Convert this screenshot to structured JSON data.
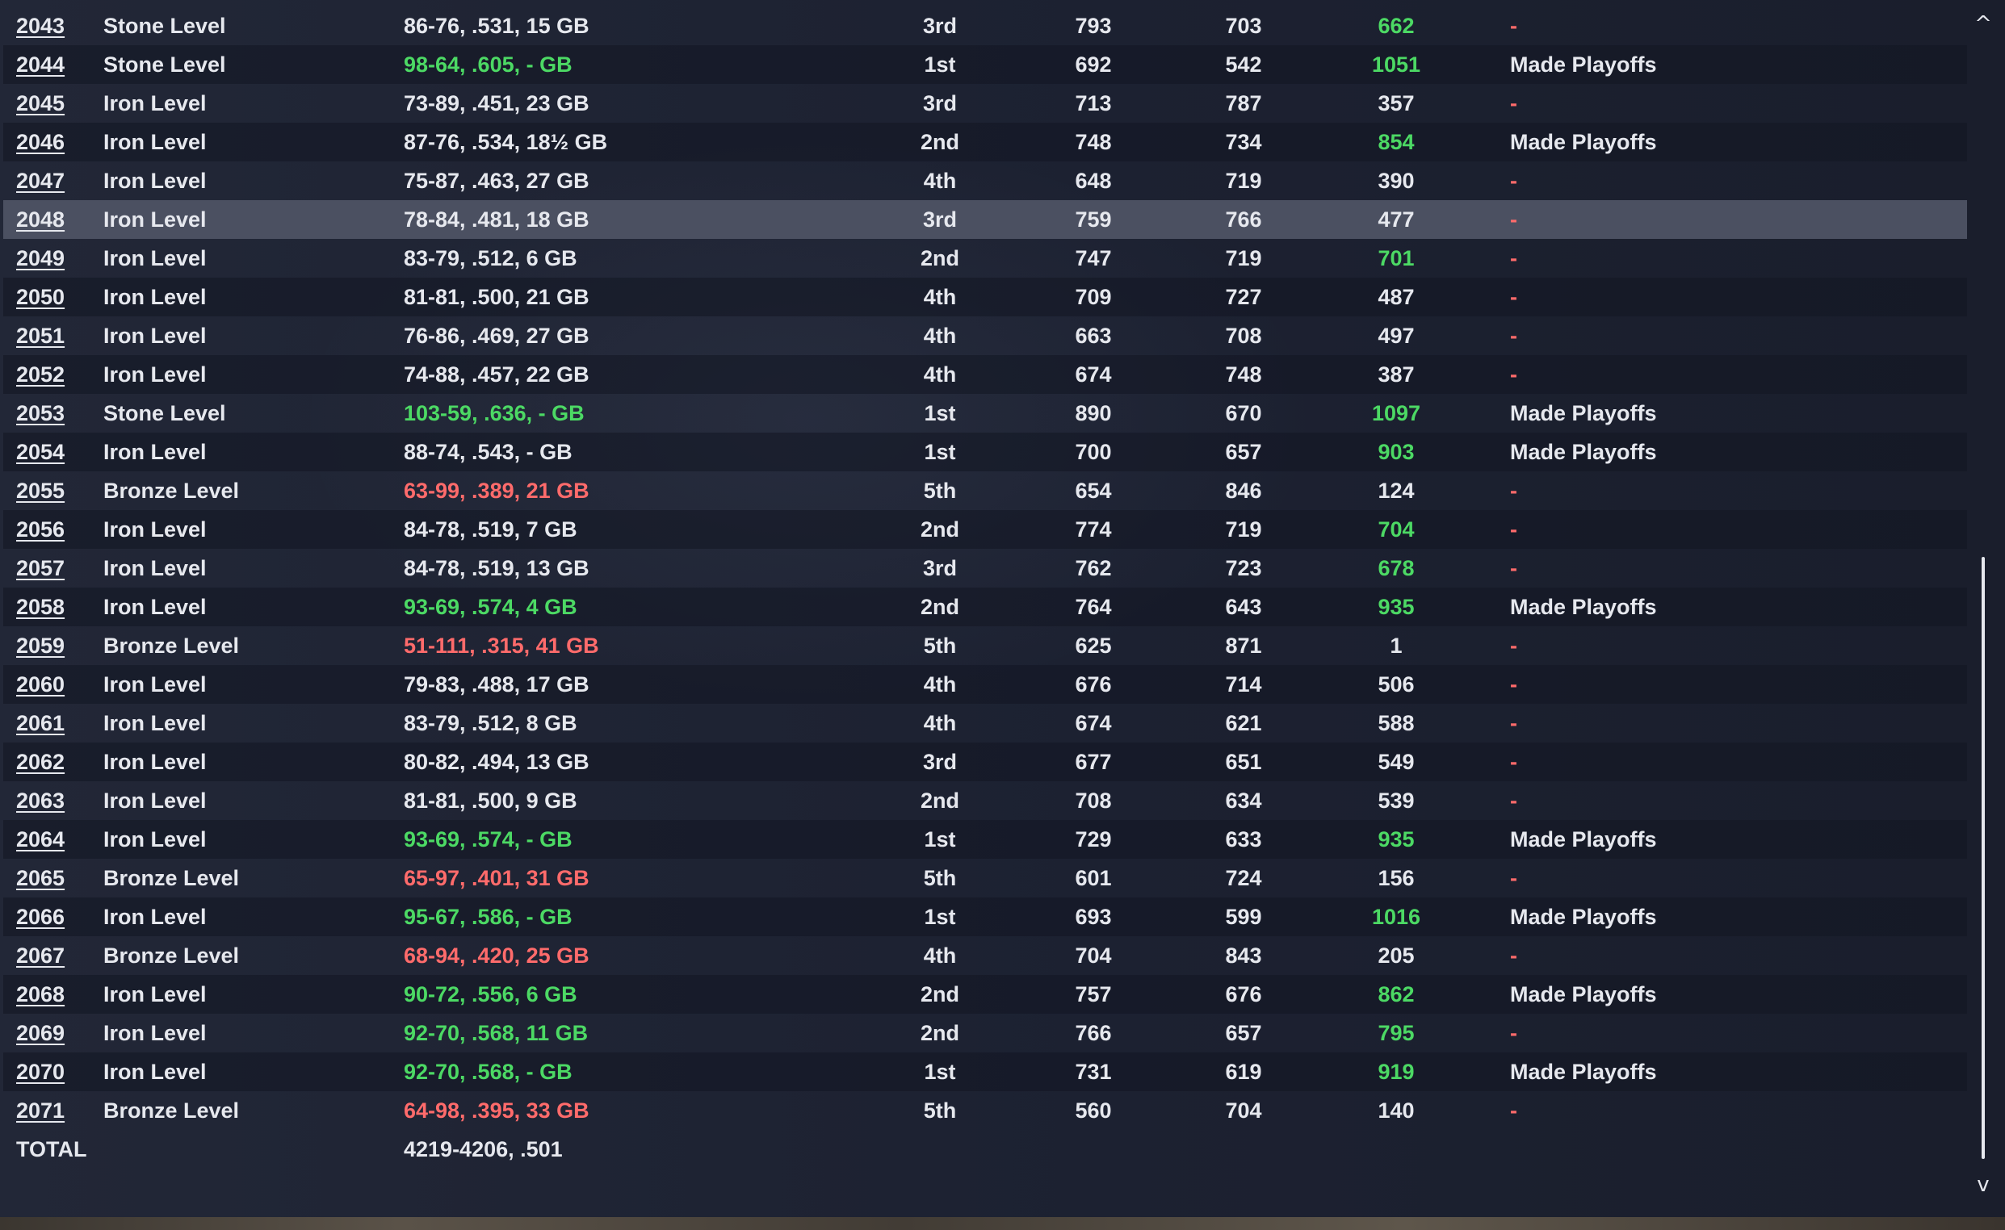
{
  "rows": [
    {
      "year": "2043",
      "level": "Stone Level",
      "record": "86-76, .531, 15 GB",
      "record_status": "normal",
      "finish": "3rd",
      "rs": "793",
      "ra": "703",
      "rating": "662",
      "rating_status": "good",
      "note": "-"
    },
    {
      "year": "2044",
      "level": "Stone Level",
      "record": "98-64, .605, - GB",
      "record_status": "good",
      "finish": "1st",
      "rs": "692",
      "ra": "542",
      "rating": "1051",
      "rating_status": "good",
      "note": "Made Playoffs"
    },
    {
      "year": "2045",
      "level": "Iron Level",
      "record": "73-89, .451, 23 GB",
      "record_status": "normal",
      "finish": "3rd",
      "rs": "713",
      "ra": "787",
      "rating": "357",
      "rating_status": "normal",
      "note": "-"
    },
    {
      "year": "2046",
      "level": "Iron Level",
      "record": "87-76, .534, 18½ GB",
      "record_status": "normal",
      "finish": "2nd",
      "rs": "748",
      "ra": "734",
      "rating": "854",
      "rating_status": "good",
      "note": "Made Playoffs"
    },
    {
      "year": "2047",
      "level": "Iron Level",
      "record": "75-87, .463, 27 GB",
      "record_status": "normal",
      "finish": "4th",
      "rs": "648",
      "ra": "719",
      "rating": "390",
      "rating_status": "normal",
      "note": "-"
    },
    {
      "year": "2048",
      "level": "Iron Level",
      "record": "78-84, .481, 18 GB",
      "record_status": "normal",
      "finish": "3rd",
      "rs": "759",
      "ra": "766",
      "rating": "477",
      "rating_status": "normal",
      "note": "-"
    },
    {
      "year": "2049",
      "level": "Iron Level",
      "record": "83-79, .512, 6 GB",
      "record_status": "normal",
      "finish": "2nd",
      "rs": "747",
      "ra": "719",
      "rating": "701",
      "rating_status": "good",
      "note": "-"
    },
    {
      "year": "2050",
      "level": "Iron Level",
      "record": "81-81, .500, 21 GB",
      "record_status": "normal",
      "finish": "4th",
      "rs": "709",
      "ra": "727",
      "rating": "487",
      "rating_status": "normal",
      "note": "-"
    },
    {
      "year": "2051",
      "level": "Iron Level",
      "record": "76-86, .469, 27 GB",
      "record_status": "normal",
      "finish": "4th",
      "rs": "663",
      "ra": "708",
      "rating": "497",
      "rating_status": "normal",
      "note": "-"
    },
    {
      "year": "2052",
      "level": "Iron Level",
      "record": "74-88, .457, 22 GB",
      "record_status": "normal",
      "finish": "4th",
      "rs": "674",
      "ra": "748",
      "rating": "387",
      "rating_status": "normal",
      "note": "-"
    },
    {
      "year": "2053",
      "level": "Stone Level",
      "record": "103-59, .636, - GB",
      "record_status": "good",
      "finish": "1st",
      "rs": "890",
      "ra": "670",
      "rating": "1097",
      "rating_status": "good",
      "note": "Made Playoffs"
    },
    {
      "year": "2054",
      "level": "Iron Level",
      "record": "88-74, .543, - GB",
      "record_status": "normal",
      "finish": "1st",
      "rs": "700",
      "ra": "657",
      "rating": "903",
      "rating_status": "good",
      "note": "Made Playoffs"
    },
    {
      "year": "2055",
      "level": "Bronze Level",
      "record": "63-99, .389, 21 GB",
      "record_status": "bad",
      "finish": "5th",
      "rs": "654",
      "ra": "846",
      "rating": "124",
      "rating_status": "normal",
      "note": "-"
    },
    {
      "year": "2056",
      "level": "Iron Level",
      "record": "84-78, .519, 7 GB",
      "record_status": "normal",
      "finish": "2nd",
      "rs": "774",
      "ra": "719",
      "rating": "704",
      "rating_status": "good",
      "note": "-"
    },
    {
      "year": "2057",
      "level": "Iron Level",
      "record": "84-78, .519, 13 GB",
      "record_status": "normal",
      "finish": "3rd",
      "rs": "762",
      "ra": "723",
      "rating": "678",
      "rating_status": "good",
      "note": "-"
    },
    {
      "year": "2058",
      "level": "Iron Level",
      "record": "93-69, .574, 4 GB",
      "record_status": "good",
      "finish": "2nd",
      "rs": "764",
      "ra": "643",
      "rating": "935",
      "rating_status": "good",
      "note": "Made Playoffs"
    },
    {
      "year": "2059",
      "level": "Bronze Level",
      "record": "51-111, .315, 41 GB",
      "record_status": "bad",
      "finish": "5th",
      "rs": "625",
      "ra": "871",
      "rating": "1",
      "rating_status": "normal",
      "note": "-"
    },
    {
      "year": "2060",
      "level": "Iron Level",
      "record": "79-83, .488, 17 GB",
      "record_status": "normal",
      "finish": "4th",
      "rs": "676",
      "ra": "714",
      "rating": "506",
      "rating_status": "normal",
      "note": "-"
    },
    {
      "year": "2061",
      "level": "Iron Level",
      "record": "83-79, .512, 8 GB",
      "record_status": "normal",
      "finish": "4th",
      "rs": "674",
      "ra": "621",
      "rating": "588",
      "rating_status": "normal",
      "note": "-"
    },
    {
      "year": "2062",
      "level": "Iron Level",
      "record": "80-82, .494, 13 GB",
      "record_status": "normal",
      "finish": "3rd",
      "rs": "677",
      "ra": "651",
      "rating": "549",
      "rating_status": "normal",
      "note": "-"
    },
    {
      "year": "2063",
      "level": "Iron Level",
      "record": "81-81, .500, 9 GB",
      "record_status": "normal",
      "finish": "2nd",
      "rs": "708",
      "ra": "634",
      "rating": "539",
      "rating_status": "normal",
      "note": "-"
    },
    {
      "year": "2064",
      "level": "Iron Level",
      "record": "93-69, .574, - GB",
      "record_status": "good",
      "finish": "1st",
      "rs": "729",
      "ra": "633",
      "rating": "935",
      "rating_status": "good",
      "note": "Made Playoffs"
    },
    {
      "year": "2065",
      "level": "Bronze Level",
      "record": "65-97, .401, 31 GB",
      "record_status": "bad",
      "finish": "5th",
      "rs": "601",
      "ra": "724",
      "rating": "156",
      "rating_status": "normal",
      "note": "-"
    },
    {
      "year": "2066",
      "level": "Iron Level",
      "record": "95-67, .586, - GB",
      "record_status": "good",
      "finish": "1st",
      "rs": "693",
      "ra": "599",
      "rating": "1016",
      "rating_status": "good",
      "note": "Made Playoffs"
    },
    {
      "year": "2067",
      "level": "Bronze Level",
      "record": "68-94, .420, 25 GB",
      "record_status": "bad",
      "finish": "4th",
      "rs": "704",
      "ra": "843",
      "rating": "205",
      "rating_status": "normal",
      "note": "-"
    },
    {
      "year": "2068",
      "level": "Iron Level",
      "record": "90-72, .556, 6 GB",
      "record_status": "good",
      "finish": "2nd",
      "rs": "757",
      "ra": "676",
      "rating": "862",
      "rating_status": "good",
      "note": "Made Playoffs"
    },
    {
      "year": "2069",
      "level": "Iron Level",
      "record": "92-70, .568, 11 GB",
      "record_status": "good",
      "finish": "2nd",
      "rs": "766",
      "ra": "657",
      "rating": "795",
      "rating_status": "good",
      "note": "-"
    },
    {
      "year": "2070",
      "level": "Iron Level",
      "record": "92-70, .568, - GB",
      "record_status": "good",
      "finish": "1st",
      "rs": "731",
      "ra": "619",
      "rating": "919",
      "rating_status": "good",
      "note": "Made Playoffs"
    },
    {
      "year": "2071",
      "level": "Bronze Level",
      "record": "64-98, .395, 33 GB",
      "record_status": "bad",
      "finish": "5th",
      "rs": "560",
      "ra": "704",
      "rating": "140",
      "rating_status": "normal",
      "note": "-"
    }
  ],
  "selected_year": "2048",
  "total": {
    "label": "TOTAL",
    "record": "4219-4206, .501"
  },
  "scrollbar": {
    "up_icon": "chevron-up-icon",
    "down_icon": "chevron-down-icon",
    "up_glyph": "^",
    "down_glyph": "v",
    "position": 0.46
  },
  "colors": {
    "good": "#4cd964",
    "bad": "#ff6b6b",
    "text": "#e6e8ee",
    "selected_row": "#4b5061"
  }
}
